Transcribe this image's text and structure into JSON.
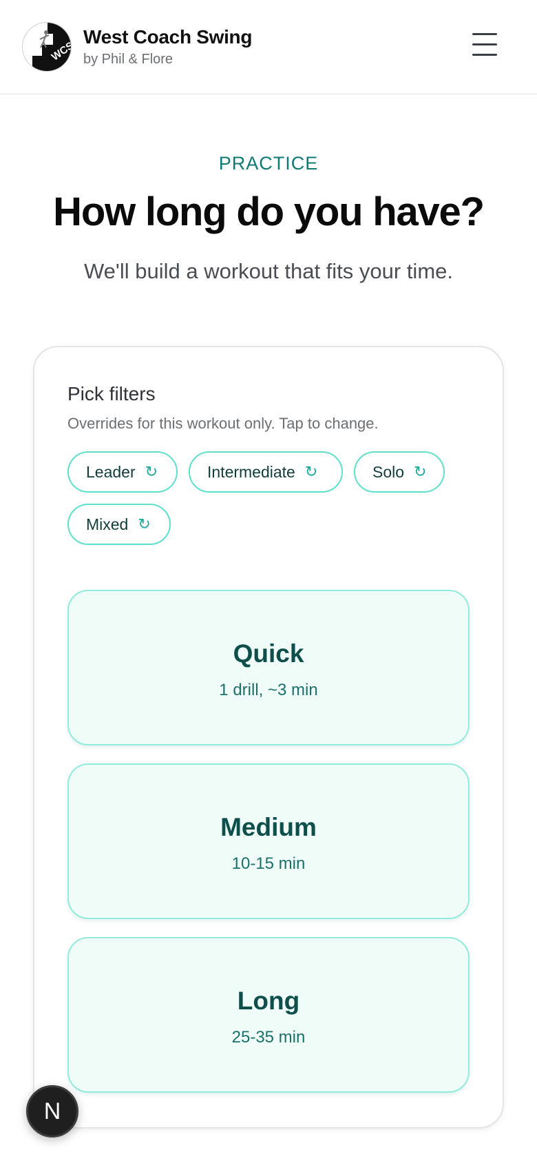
{
  "header": {
    "brand_title": "West Coach Swing",
    "brand_subtitle": "by Phil & Flore",
    "logo_text": "WCS",
    "menu_icon": "hamburger-menu-icon"
  },
  "intro": {
    "eyebrow": "PRACTICE",
    "headline": "How long do you have?",
    "subhead": "We'll build a workout that fits your time."
  },
  "filters": {
    "title": "Pick filters",
    "description": "Overrides for this workout only. Tap to change.",
    "cycle_icon": "↻",
    "chips": [
      {
        "label": "Leader"
      },
      {
        "label": "Intermediate"
      },
      {
        "label": "Solo"
      },
      {
        "label": "Mixed"
      }
    ]
  },
  "durations": [
    {
      "title": "Quick",
      "detail": "1 drill, ~3 min"
    },
    {
      "title": "Medium",
      "detail": "10-15 min"
    },
    {
      "title": "Long",
      "detail": "25-35 min"
    }
  ],
  "devtools": {
    "label": "N"
  },
  "colors": {
    "accent": "#0f7a72",
    "chip_border": "#5ee0cc",
    "option_bg": "#effcf8",
    "option_border": "#92ecdc",
    "option_title": "#0e4e4b"
  }
}
